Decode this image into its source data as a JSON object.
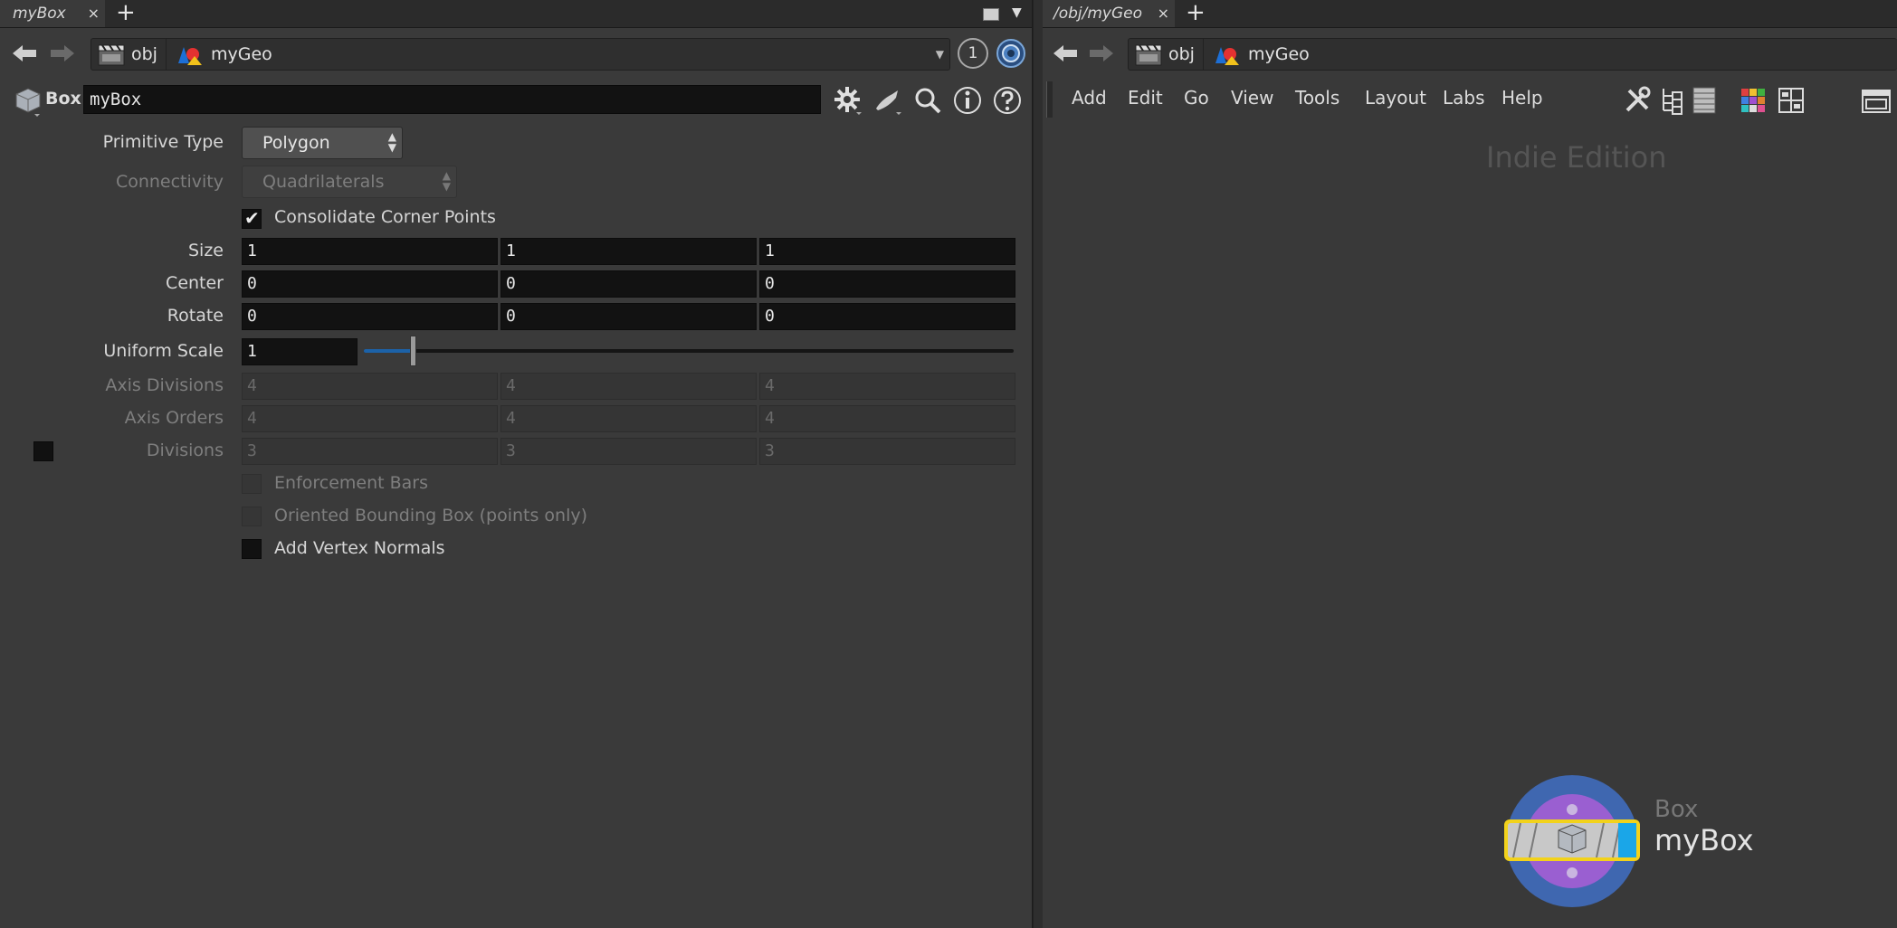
{
  "left_pane": {
    "tab": {
      "title": "myBox",
      "close": "×"
    },
    "add_tab": "+",
    "path": {
      "root": "obj",
      "node": "myGeo",
      "pin_label": "1"
    },
    "params_header": {
      "type_label": "Box",
      "node_name": "myBox"
    },
    "params": {
      "primitive_type": {
        "label": "Primitive Type",
        "value": "Polygon"
      },
      "connectivity": {
        "label": "Connectivity",
        "value": "Quadrilaterals"
      },
      "consolidate": {
        "label": "Consolidate Corner Points",
        "checked": true,
        "check_glyph": "✔"
      },
      "size": {
        "label": "Size",
        "values": [
          "1",
          "1",
          "1"
        ]
      },
      "center": {
        "label": "Center",
        "values": [
          "0",
          "0",
          "0"
        ]
      },
      "rotate": {
        "label": "Rotate",
        "values": [
          "0",
          "0",
          "0"
        ]
      },
      "uniform_scale": {
        "label": "Uniform Scale",
        "value": "1",
        "slider_fraction": 0.075
      },
      "axis_divisions": {
        "label": "Axis Divisions",
        "values": [
          "4",
          "4",
          "4"
        ]
      },
      "axis_orders": {
        "label": "Axis Orders",
        "values": [
          "4",
          "4",
          "4"
        ]
      },
      "divisions": {
        "label": "Divisions",
        "values": [
          "3",
          "3",
          "3"
        ]
      },
      "enforcement_bars": {
        "label": "Enforcement Bars"
      },
      "oriented_bbox": {
        "label": "Oriented Bounding Box (points only)"
      },
      "vertex_normals": {
        "label": "Add Vertex Normals"
      }
    }
  },
  "right_pane": {
    "tab": {
      "title": "/obj/myGeo",
      "close": "×"
    },
    "add_tab": "+",
    "path": {
      "root": "obj",
      "node": "myGeo"
    },
    "menu": [
      "Add",
      "Edit",
      "Go",
      "View",
      "Tools",
      "Layout",
      "Labs",
      "Help"
    ],
    "watermark": "Indie Edition",
    "node": {
      "type": "Box",
      "name": "myBox"
    }
  },
  "colors": {
    "accent_blue": "#1c62a8",
    "node_flag_blue": "#1aa6e8",
    "node_select_yellow": "#f2d21b",
    "ring_blue": "#3f67b0",
    "ring_purple": "#9a5fd1"
  }
}
